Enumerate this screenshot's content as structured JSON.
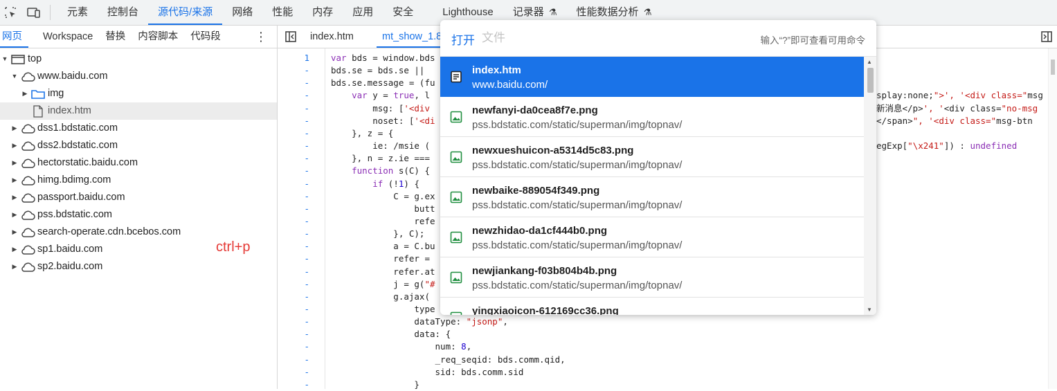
{
  "toolbar": {
    "tabs": [
      {
        "label": "元素"
      },
      {
        "label": "控制台"
      },
      {
        "label": "源代码/来源"
      },
      {
        "label": "网络"
      },
      {
        "label": "性能"
      },
      {
        "label": "内存"
      },
      {
        "label": "应用"
      },
      {
        "label": "安全"
      },
      {
        "label": "Lighthouse"
      },
      {
        "label": "记录器"
      },
      {
        "label": "性能数据分析"
      }
    ],
    "active_tab": "源代码/来源"
  },
  "navigator": {
    "tabs": [
      {
        "label": "网页"
      },
      {
        "label": "Workspace"
      },
      {
        "label": "替换"
      },
      {
        "label": "内容脚本"
      },
      {
        "label": "代码段"
      }
    ],
    "more": "⋮",
    "tree": [
      {
        "label": "top",
        "icon": "frame-icon",
        "expanded": true
      },
      {
        "label": "www.baidu.com",
        "icon": "cloud-icon",
        "expanded": true
      },
      {
        "label": "img",
        "icon": "folder-icon",
        "expanded": false
      },
      {
        "label": "index.htm",
        "icon": "file-icon",
        "selected": true
      },
      {
        "label": "dss1.bdstatic.com",
        "icon": "cloud-icon"
      },
      {
        "label": "dss2.bdstatic.com",
        "icon": "cloud-icon"
      },
      {
        "label": "hectorstatic.baidu.com",
        "icon": "cloud-icon"
      },
      {
        "label": "himg.bdimg.com",
        "icon": "cloud-icon"
      },
      {
        "label": "passport.baidu.com",
        "icon": "cloud-icon"
      },
      {
        "label": "pss.bdstatic.com",
        "icon": "cloud-icon"
      },
      {
        "label": "search-operate.cdn.bcebos.com",
        "icon": "cloud-icon"
      },
      {
        "label": "sp1.baidu.com",
        "icon": "cloud-icon"
      },
      {
        "label": "sp2.baidu.com",
        "icon": "cloud-icon"
      }
    ],
    "annotation": "ctrl+p"
  },
  "editor": {
    "tabs": [
      {
        "label": "index.htm"
      },
      {
        "label": "mt_show_1.8"
      }
    ],
    "gutter": [
      "1",
      "-",
      "-",
      "-",
      "-",
      "-",
      "-",
      "-",
      "-",
      "-",
      "-",
      "-",
      "-",
      "-",
      "-",
      "-",
      "-",
      "-",
      "-",
      "-",
      "-",
      "-",
      "-",
      "-",
      "-",
      "-",
      "-"
    ],
    "lines": [
      "var bds = window.bds",
      "bds.se = bds.se || ",
      "bds.se.message = (fu",
      "    var y = true, l",
      "        msg: ['<div",
      "        noset: ['<di",
      "    }, z = {",
      "        ie: /msie (",
      "    }, n = z.ie ===",
      "    function s(C) {",
      "        if (!1) {",
      "            C = g.ex",
      "                butt",
      "                refe",
      "            }, C);",
      "            a = C.bu",
      "            refer =",
      "            refer.at",
      "            j = g(\"#",
      "            g.ajax(",
      "                type",
      "                dataType: \"jsonp\",",
      "                data: {",
      "                    num: 8,",
      "                    _req_seqid: bds.comm.qid,",
      "                    sid: bds.comm.sid",
      "                }"
    ],
    "right_fragments": [
      "splay:none;\">', '<div class=\"msg",
      "新消息</p>', '<div class=\"no-msg",
      "</span>\", '<div class=\"msg-btn",
      "egExp[\"\\x241\"]) : undefined"
    ]
  },
  "quick_open": {
    "prefix": "打开",
    "placeholder": "文件",
    "hint": "输入“?”即可查看可用命令",
    "items": [
      {
        "title": "index.htm",
        "subtitle": "www.baidu.com/",
        "icon": "document-icon",
        "selected": true
      },
      {
        "title": "newfanyi-da0cea8f7e.png",
        "subtitle": "pss.bdstatic.com/static/superman/img/topnav/",
        "icon": "image-icon"
      },
      {
        "title": "newxueshuicon-a5314d5c83.png",
        "subtitle": "pss.bdstatic.com/static/superman/img/topnav/",
        "icon": "image-icon"
      },
      {
        "title": "newbaike-889054f349.png",
        "subtitle": "pss.bdstatic.com/static/superman/img/topnav/",
        "icon": "image-icon"
      },
      {
        "title": "newzhidao-da1cf444b0.png",
        "subtitle": "pss.bdstatic.com/static/superman/img/topnav/",
        "icon": "image-icon"
      },
      {
        "title": "newjiankang-f03b804b4b.png",
        "subtitle": "pss.bdstatic.com/static/superman/img/topnav/",
        "icon": "image-icon"
      },
      {
        "title": "yingxiaoicon-612169cc36.png",
        "subtitle": "",
        "icon": "image-icon"
      }
    ]
  },
  "colors": {
    "accent": "#1a73e8",
    "selected_bg": "#1a73e8",
    "annotation": "#e53935"
  }
}
